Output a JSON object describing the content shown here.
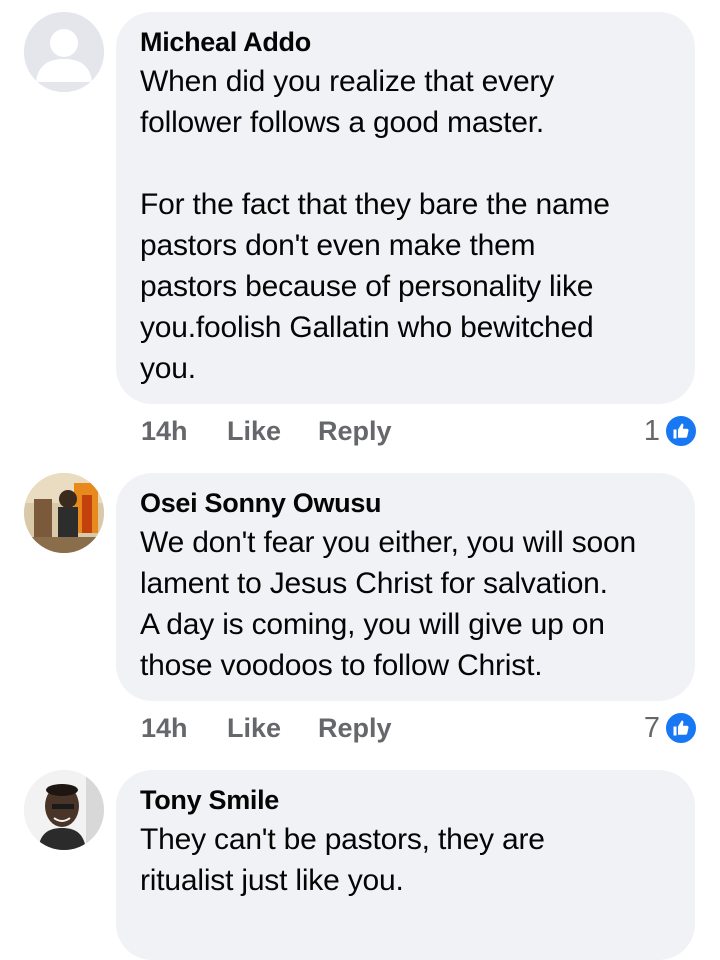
{
  "comments": [
    {
      "author": "Micheal Addo",
      "text": "When did you realize that every\nfollower follows a good master.\n\nFor the fact that they bare the name\npastors don't even make them\npastors because of personality like\nyou.foolish Gallatin who bewitched\nyou.",
      "time": "14h",
      "like_label": "Like",
      "reply_label": "Reply",
      "reaction_count": "1",
      "reaction_icon": "thumbs-up-icon",
      "avatar": "default-avatar-icon"
    },
    {
      "author": "Osei Sonny Owusu",
      "text": "We don't fear you either, you will soon\nlament to Jesus Christ for salvation.\nA day is coming, you will give up on\nthose voodoos to follow Christ.",
      "time": "14h",
      "like_label": "Like",
      "reply_label": "Reply",
      "reaction_count": "7",
      "reaction_icon": "thumbs-up-icon",
      "avatar": "photo-avatar"
    },
    {
      "author": "Tony Smile",
      "text": "They can't be pastors, they are\nritualist just like you.",
      "avatar": "photo-avatar"
    }
  ],
  "colors": {
    "bubble_bg": "#f0f2f5",
    "meta_text": "#65676b",
    "like_blue": "#1877f2"
  }
}
